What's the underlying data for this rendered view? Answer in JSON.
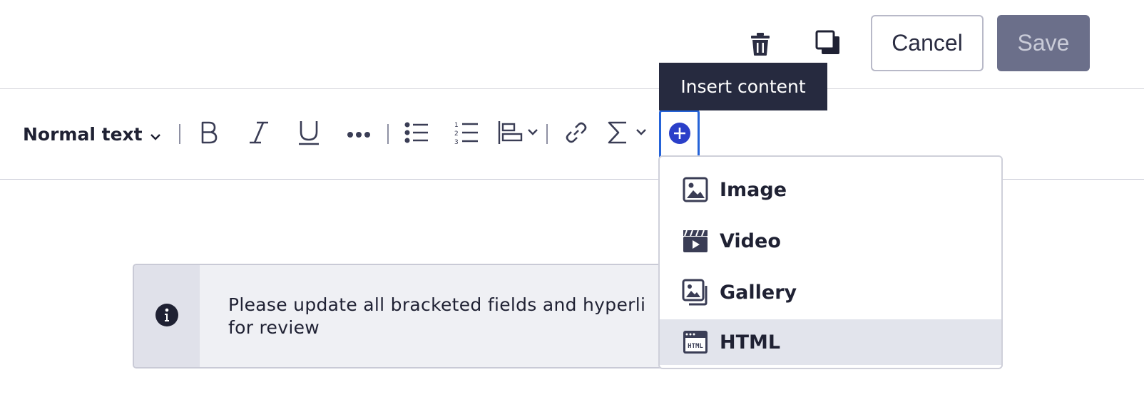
{
  "header": {
    "delete_icon": "trash-icon",
    "duplicate_icon": "duplicate-icon",
    "cancel_label": "Cancel",
    "save_label": "Save"
  },
  "toolbar": {
    "text_style": "Normal text",
    "buttons": [
      "bold-icon",
      "italic-icon",
      "underline-icon",
      "more-icon",
      "bullet-list-icon",
      "numbered-list-icon",
      "align-icon",
      "link-icon",
      "sigma-icon",
      "plus-circle-icon"
    ],
    "insert_tooltip": "Insert content"
  },
  "insert_menu": {
    "items": [
      {
        "label": "Image",
        "icon": "image-icon"
      },
      {
        "label": "Video",
        "icon": "video-icon"
      },
      {
        "label": "Gallery",
        "icon": "gallery-icon"
      },
      {
        "label": "HTML",
        "icon": "html-icon",
        "highlighted": true
      }
    ]
  },
  "banner": {
    "icon": "info-icon",
    "text": "Please update all bracketed fields and hyperli… for review",
    "line1": "Please update all bracketed fields and hyperli",
    "line2": "for review"
  },
  "colors": {
    "accent": "#2563d8",
    "tooltip_bg": "#262a3f",
    "save_bg": "#6b6f8a",
    "menu_hover": "#e2e4ec",
    "banner_bg": "#eff0f4"
  }
}
